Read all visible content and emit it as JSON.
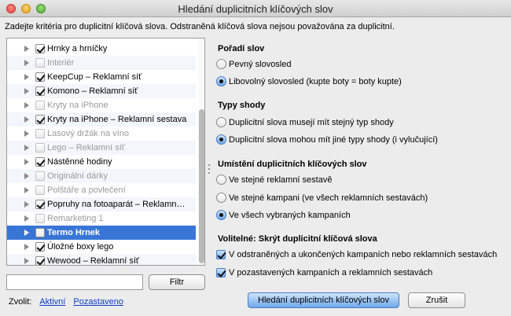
{
  "window": {
    "title": "Hledání duplicitních klíčových slov"
  },
  "instructions": "Zadejte kritéria pro duplicitní klíčová slova. Odstraněná klíčová slova nejsou považována za duplicitní.",
  "list": {
    "items": [
      {
        "label": "Hrnky a hrníčky",
        "checked": true,
        "disabled": false,
        "selected": false
      },
      {
        "label": "Interiér",
        "checked": false,
        "disabled": true,
        "selected": false
      },
      {
        "label": "KeepCup – Reklamní síť",
        "checked": true,
        "disabled": false,
        "selected": false
      },
      {
        "label": "Komono – Reklamní síť",
        "checked": true,
        "disabled": false,
        "selected": false
      },
      {
        "label": "Kryty na iPhone",
        "checked": false,
        "disabled": true,
        "selected": false
      },
      {
        "label": "Kryty na iPhone – Reklamní sestava",
        "checked": true,
        "disabled": false,
        "selected": false
      },
      {
        "label": "Lasový držák na víno",
        "checked": false,
        "disabled": true,
        "selected": false
      },
      {
        "label": "Lego – Reklamní síť",
        "checked": false,
        "disabled": true,
        "selected": false
      },
      {
        "label": "Nástěnné hodiny",
        "checked": true,
        "disabled": false,
        "selected": false
      },
      {
        "label": "Originální dárky",
        "checked": false,
        "disabled": true,
        "selected": false
      },
      {
        "label": "Polštáře a povlečení",
        "checked": false,
        "disabled": true,
        "selected": false
      },
      {
        "label": "Popruhy na fotoaparát – Reklamn…",
        "checked": true,
        "disabled": false,
        "selected": false
      },
      {
        "label": "Remarketing 1",
        "checked": false,
        "disabled": true,
        "selected": false
      },
      {
        "label": "Termo Hrnek",
        "checked": false,
        "disabled": false,
        "selected": true
      },
      {
        "label": "Úložné boxy lego",
        "checked": true,
        "disabled": false,
        "selected": false
      },
      {
        "label": "Wewood – Reklamní síť",
        "checked": true,
        "disabled": false,
        "selected": false
      }
    ]
  },
  "filter": {
    "value": "",
    "placeholder": "",
    "button_label": "Filtr"
  },
  "show": {
    "label": "Zvolit:",
    "active_link": "Aktivní",
    "paused_link": "Pozastaveno"
  },
  "word_order": {
    "title": "Pořadí slov",
    "options": [
      {
        "label": "Pevný slovosled",
        "selected": false
      },
      {
        "label": "Libovolný slovosled (kupte boty = boty kupte)",
        "selected": true
      }
    ]
  },
  "match_types": {
    "title": "Typy shody",
    "options": [
      {
        "label": "Duplicitní slova musejí mít stejný typ shody",
        "selected": false
      },
      {
        "label": "Duplicitní slova mohou mít jiné typy shody (i vylučující)",
        "selected": true
      }
    ]
  },
  "location": {
    "title": "Umístění duplicitních klíčových slov",
    "options": [
      {
        "label": "Ve stejné reklamní sestavě",
        "selected": false
      },
      {
        "label": "Ve stejné kampani (ve všech reklamních sestavách)",
        "selected": false
      },
      {
        "label": "Ve všech vybraných kampaních",
        "selected": true
      }
    ]
  },
  "optional": {
    "title": "Volitelné: Skrýt duplicitní klíčová slova",
    "options": [
      {
        "label": "V odstraněných a ukončených kampaních nebo reklamních sestavách",
        "checked": true
      },
      {
        "label": "V pozastavených kampaních a reklamních sestavách",
        "checked": true
      }
    ]
  },
  "actions": {
    "find_label": "Hledání duplicitních klíčových slov",
    "cancel_label": "Zrušit"
  }
}
